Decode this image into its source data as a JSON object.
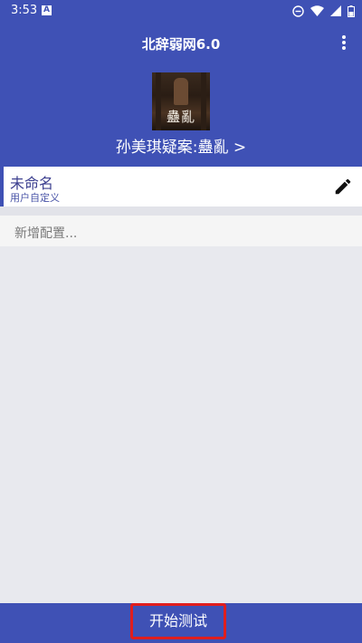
{
  "status_bar": {
    "time": "3:53",
    "app_icon_letter": "A",
    "icons": [
      "do-not-disturb-icon",
      "wifi-icon",
      "signal-icon",
      "battery-icon"
    ]
  },
  "app_bar": {
    "title": "北辞弱网6.0",
    "menu_icon": "more-vert-icon",
    "cover_text": "蠱亂",
    "book_link": "孙美琪疑案:蠱亂 >"
  },
  "config_list": {
    "items": [
      {
        "name": "未命名",
        "type": "用户自定义",
        "icon": "edit-pencil-icon"
      }
    ],
    "add_label": "新增配置..."
  },
  "bottom_bar": {
    "start_label": "开始测试",
    "highlight_color": "#e01e1e"
  },
  "colors": {
    "primary": "#3f51b5",
    "background": "#e8e9ee",
    "item_text": "#3c3f8f"
  }
}
